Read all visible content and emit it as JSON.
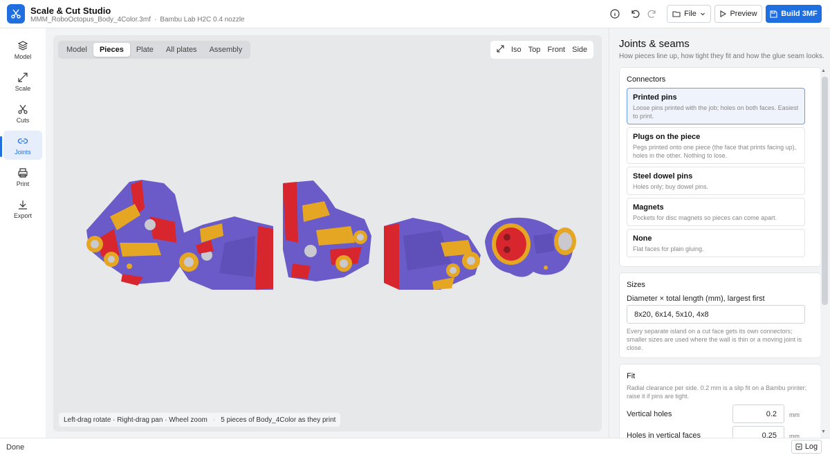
{
  "header": {
    "app_title": "Scale & Cut Studio",
    "file_name": "MMM_RoboOctopus_Body_4Color.3mf",
    "separator": "·",
    "printer": "Bambu Lab H2C 0.4 nozzle",
    "file_label": "File",
    "preview_label": "Preview",
    "build_label": "Build 3MF"
  },
  "nav": {
    "items": [
      {
        "label": "Model",
        "icon": "layers-icon"
      },
      {
        "label": "Scale",
        "icon": "resize-arrow-icon"
      },
      {
        "label": "Cuts",
        "icon": "scissors-icon"
      },
      {
        "label": "Joints",
        "icon": "link-icon"
      },
      {
        "label": "Print",
        "icon": "printer-icon"
      },
      {
        "label": "Export",
        "icon": "download-icon"
      }
    ],
    "active": "Joints"
  },
  "viewport": {
    "tabs": [
      "Model",
      "Pieces",
      "Plate",
      "All plates",
      "Assembly"
    ],
    "active_tab": "Pieces",
    "views": [
      "Iso",
      "Top",
      "Front",
      "Side"
    ],
    "hint": "Left-drag rotate · Right-drag pan · Wheel zoom",
    "hint_sep": "·",
    "pieces_info": "5 pieces of Body_4Color as they print",
    "colors": {
      "purple": "#6a5bc9",
      "red": "#d8262e",
      "gold": "#e5a623",
      "grey": "#c9c9cf"
    }
  },
  "panel": {
    "title": "Joints & seams",
    "subtitle": "How pieces line up, how tight they fit and how the glue seam looks.",
    "connectors": {
      "title": "Connectors",
      "options": [
        {
          "title": "Printed pins",
          "desc": "Loose pins printed with the job; holes on both faces. Easiest to print.",
          "selected": true
        },
        {
          "title": "Plugs on the piece",
          "desc": "Pegs printed onto one piece (the face that prints facing up), holes in the other. Nothing to lose.",
          "selected": false
        },
        {
          "title": "Steel dowel pins",
          "desc": "Holes only; buy dowel pins.",
          "selected": false
        },
        {
          "title": "Magnets",
          "desc": "Pockets for disc magnets so pieces can come apart.",
          "selected": false
        },
        {
          "title": "None",
          "desc": "Flat faces for plain gluing.",
          "selected": false
        }
      ]
    },
    "sizes": {
      "title": "Sizes",
      "label": "Diameter × total length (mm), largest first",
      "value": "8x20, 6x14, 5x10, 4x8",
      "help": "Every separate island on a cut face gets its own connectors; smaller sizes are used where the wall is thin or a moving joint is close."
    },
    "fit": {
      "title": "Fit",
      "help": "Radial clearance per side. 0.2 mm is a slip fit on a Bambu printer; raise it if pins are tight.",
      "rows": [
        {
          "label": "Vertical holes",
          "value": "0.2",
          "unit": "mm"
        },
        {
          "label": "Holes in vertical faces",
          "value": "0.25",
          "unit": "mm"
        }
      ]
    }
  },
  "status": {
    "text": "Done",
    "log_label": "Log"
  }
}
